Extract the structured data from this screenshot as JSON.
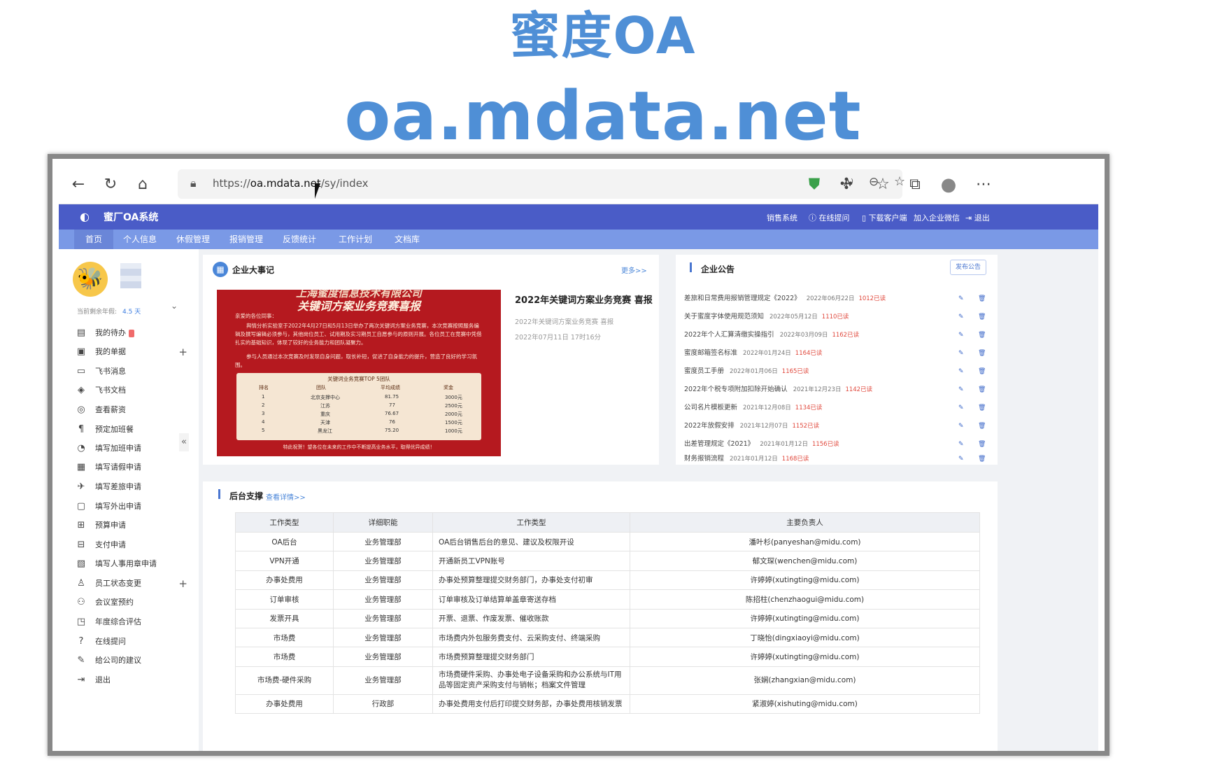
{
  "hero": {
    "title": "蜜度OA",
    "url_big": "oa.mdata.net"
  },
  "browser": {
    "url_prefix": "https://",
    "url_domain": "oa.mdata.net",
    "url_path": "/sy/index"
  },
  "app": {
    "name": "蜜厂OA系统",
    "topright": [
      "销售系统",
      "在线提问",
      "下载客户端",
      "加入企业微信",
      "退出"
    ],
    "nav": [
      "首页",
      "个人信息",
      "休假管理",
      "报销管理",
      "反馈统计",
      "工作计划",
      "文档库"
    ]
  },
  "sidebar": {
    "leave_label": "当前剩余年假:",
    "leave_value": "4.5 天",
    "items": [
      {
        "label": "我的待办",
        "icon": "todo-icon"
      },
      {
        "label": "我的单据",
        "icon": "document-icon"
      },
      {
        "label": "飞书消息",
        "icon": "message-icon"
      },
      {
        "label": "飞书文档",
        "icon": "file-icon"
      },
      {
        "label": "查看薪资",
        "icon": "salary-icon"
      },
      {
        "label": "预定加班餐",
        "icon": "meal-icon"
      },
      {
        "label": "填写加班申请",
        "icon": "overtime-icon"
      },
      {
        "label": "填写请假申请",
        "icon": "leave-icon"
      },
      {
        "label": "填写差旅申请",
        "icon": "travel-icon"
      },
      {
        "label": "填写外出申请",
        "icon": "outing-icon"
      },
      {
        "label": "预算申请",
        "icon": "budget-icon"
      },
      {
        "label": "支付申请",
        "icon": "payment-icon"
      },
      {
        "label": "填写人事用章申请",
        "icon": "seal-icon"
      },
      {
        "label": "员工状态变更",
        "icon": "user-icon"
      },
      {
        "label": "会议室预约",
        "icon": "meeting-icon"
      },
      {
        "label": "年度综合评估",
        "icon": "evaluation-icon"
      },
      {
        "label": "在线提问",
        "icon": "question-icon"
      },
      {
        "label": "给公司的建议",
        "icon": "suggestion-icon"
      },
      {
        "label": "退出",
        "icon": "logout-icon"
      }
    ]
  },
  "events": {
    "title": "企业大事记",
    "more": "更多>>",
    "poster": {
      "company": "上海蜜度信息技术有限公司",
      "headline": "关键词方案业务竞赛喜报",
      "greeting": "亲爱的各位同事：",
      "para1": "舆情分析实验室于2022年4月27日和5月13日举办了两次关键词方案业务竞赛，本次竞赛按照服务编辑及撰写编辑必须参与，其他岗位员工、试用期及实习期员工自愿参与的原则开展。各位员工在竞赛中凭借扎实的基础知识，体现了较好的业务能力和团队凝聚力。",
      "para2": "参与人员通过本次竞赛及时发现自身问题，取长补短，促进了自身能力的提升，营造了良好的学习氛围。",
      "table_title": "关键词业务竞赛TOP 5团队",
      "table_headers": [
        "排名",
        "团队",
        "平均成绩",
        "奖金"
      ],
      "table_rows": [
        [
          "1",
          "北京支撑中心",
          "81.75",
          "3000元"
        ],
        [
          "2",
          "江苏",
          "77",
          "2500元"
        ],
        [
          "3",
          "重庆",
          "76.67",
          "2000元"
        ],
        [
          "4",
          "天津",
          "76",
          "1500元"
        ],
        [
          "5",
          "黑龙江",
          "75.20",
          "1000元"
        ]
      ],
      "footer": "特此祝贺！望各位在未来的工作中不断提高业务水平，取得优异成绩！"
    },
    "news_title": "2022年关键词方案业务竞赛 喜报",
    "news_subtitle": "2022年关键词方案业务竞赛 喜报",
    "news_date": "2022年07月11日 17时16分"
  },
  "announcements": {
    "title": "企业公告",
    "publish_button": "发布公告",
    "items": [
      {
        "title": "差旅和日常费用报销管理规定《2022》",
        "date": "2022年06月22日",
        "reads": "1012已读"
      },
      {
        "title": "关于蜜度字体使用规范须知",
        "date": "2022年05月12日",
        "reads": "1110已读"
      },
      {
        "title": "2022年个人汇算清缴实操指引",
        "date": "2022年03月09日",
        "reads": "1162已读"
      },
      {
        "title": "蜜度邮箱签名标准",
        "date": "2022年01月24日",
        "reads": "1164已读"
      },
      {
        "title": "蜜度员工手册",
        "date": "2022年01月06日",
        "reads": "1165已读"
      },
      {
        "title": "2022年个税专项附加扣除开始确认",
        "date": "2021年12月23日",
        "reads": "1142已读"
      },
      {
        "title": "公司名片模板更新",
        "date": "2021年12月08日",
        "reads": "1134已读"
      },
      {
        "title": "2022年放假安排",
        "date": "2021年12月07日",
        "reads": "1152已读"
      },
      {
        "title": "出差管理规定《2021》",
        "date": "2021年01月12日",
        "reads": "1156已读"
      },
      {
        "title": "财务报销流程",
        "date": "2021年01月12日",
        "reads": "1168已读"
      }
    ]
  },
  "support": {
    "title": "后台支撑",
    "details_link": "查看详情>>",
    "headers": [
      "工作类型",
      "详细职能",
      "工作类型",
      "主要负责人"
    ],
    "rows": [
      [
        "OA后台",
        "业务管理部",
        "OA后台销售后台的意见、建议及权限开设",
        "潘叶杉(panyeshan@midu.com)"
      ],
      [
        "VPN开通",
        "业务管理部",
        "开通新员工VPN账号",
        "郁文琛(wenchen@midu.com)"
      ],
      [
        "办事处费用",
        "业务管理部",
        "办事处预算整理提交财务部门，办事处支付初审",
        "许婷婷(xutingting@midu.com)"
      ],
      [
        "订单审核",
        "业务管理部",
        "订单审核及订单结算单盖章寄送存档",
        "陈招柱(chenzhaogui@midu.com)"
      ],
      [
        "发票开具",
        "业务管理部",
        "开票、退票、作废发票、催收账款",
        "许婷婷(xutingting@midu.com)"
      ],
      [
        "市场费",
        "业务管理部",
        "市场费内外包服务费支付、云采购支付、终端采购",
        "丁晓怡(dingxiaoyi@midu.com)"
      ],
      [
        "市场费",
        "业务管理部",
        "市场费预算整理提交财务部门",
        "许婷婷(xutingting@midu.com)"
      ],
      [
        "市场费-硬件采购",
        "业务管理部",
        "市场费硬件采购、办事处电子设备采购和办公系统与IT用品等固定资产采购支付与销帐；档案文件管理",
        "张娴(zhangxian@midu.com)"
      ],
      [
        "办事处费用",
        "行政部",
        "办事处费用支付后打印提交财务部，办事处费用核销发票",
        "紧淑婷(xishuting@midu.com)"
      ]
    ]
  }
}
